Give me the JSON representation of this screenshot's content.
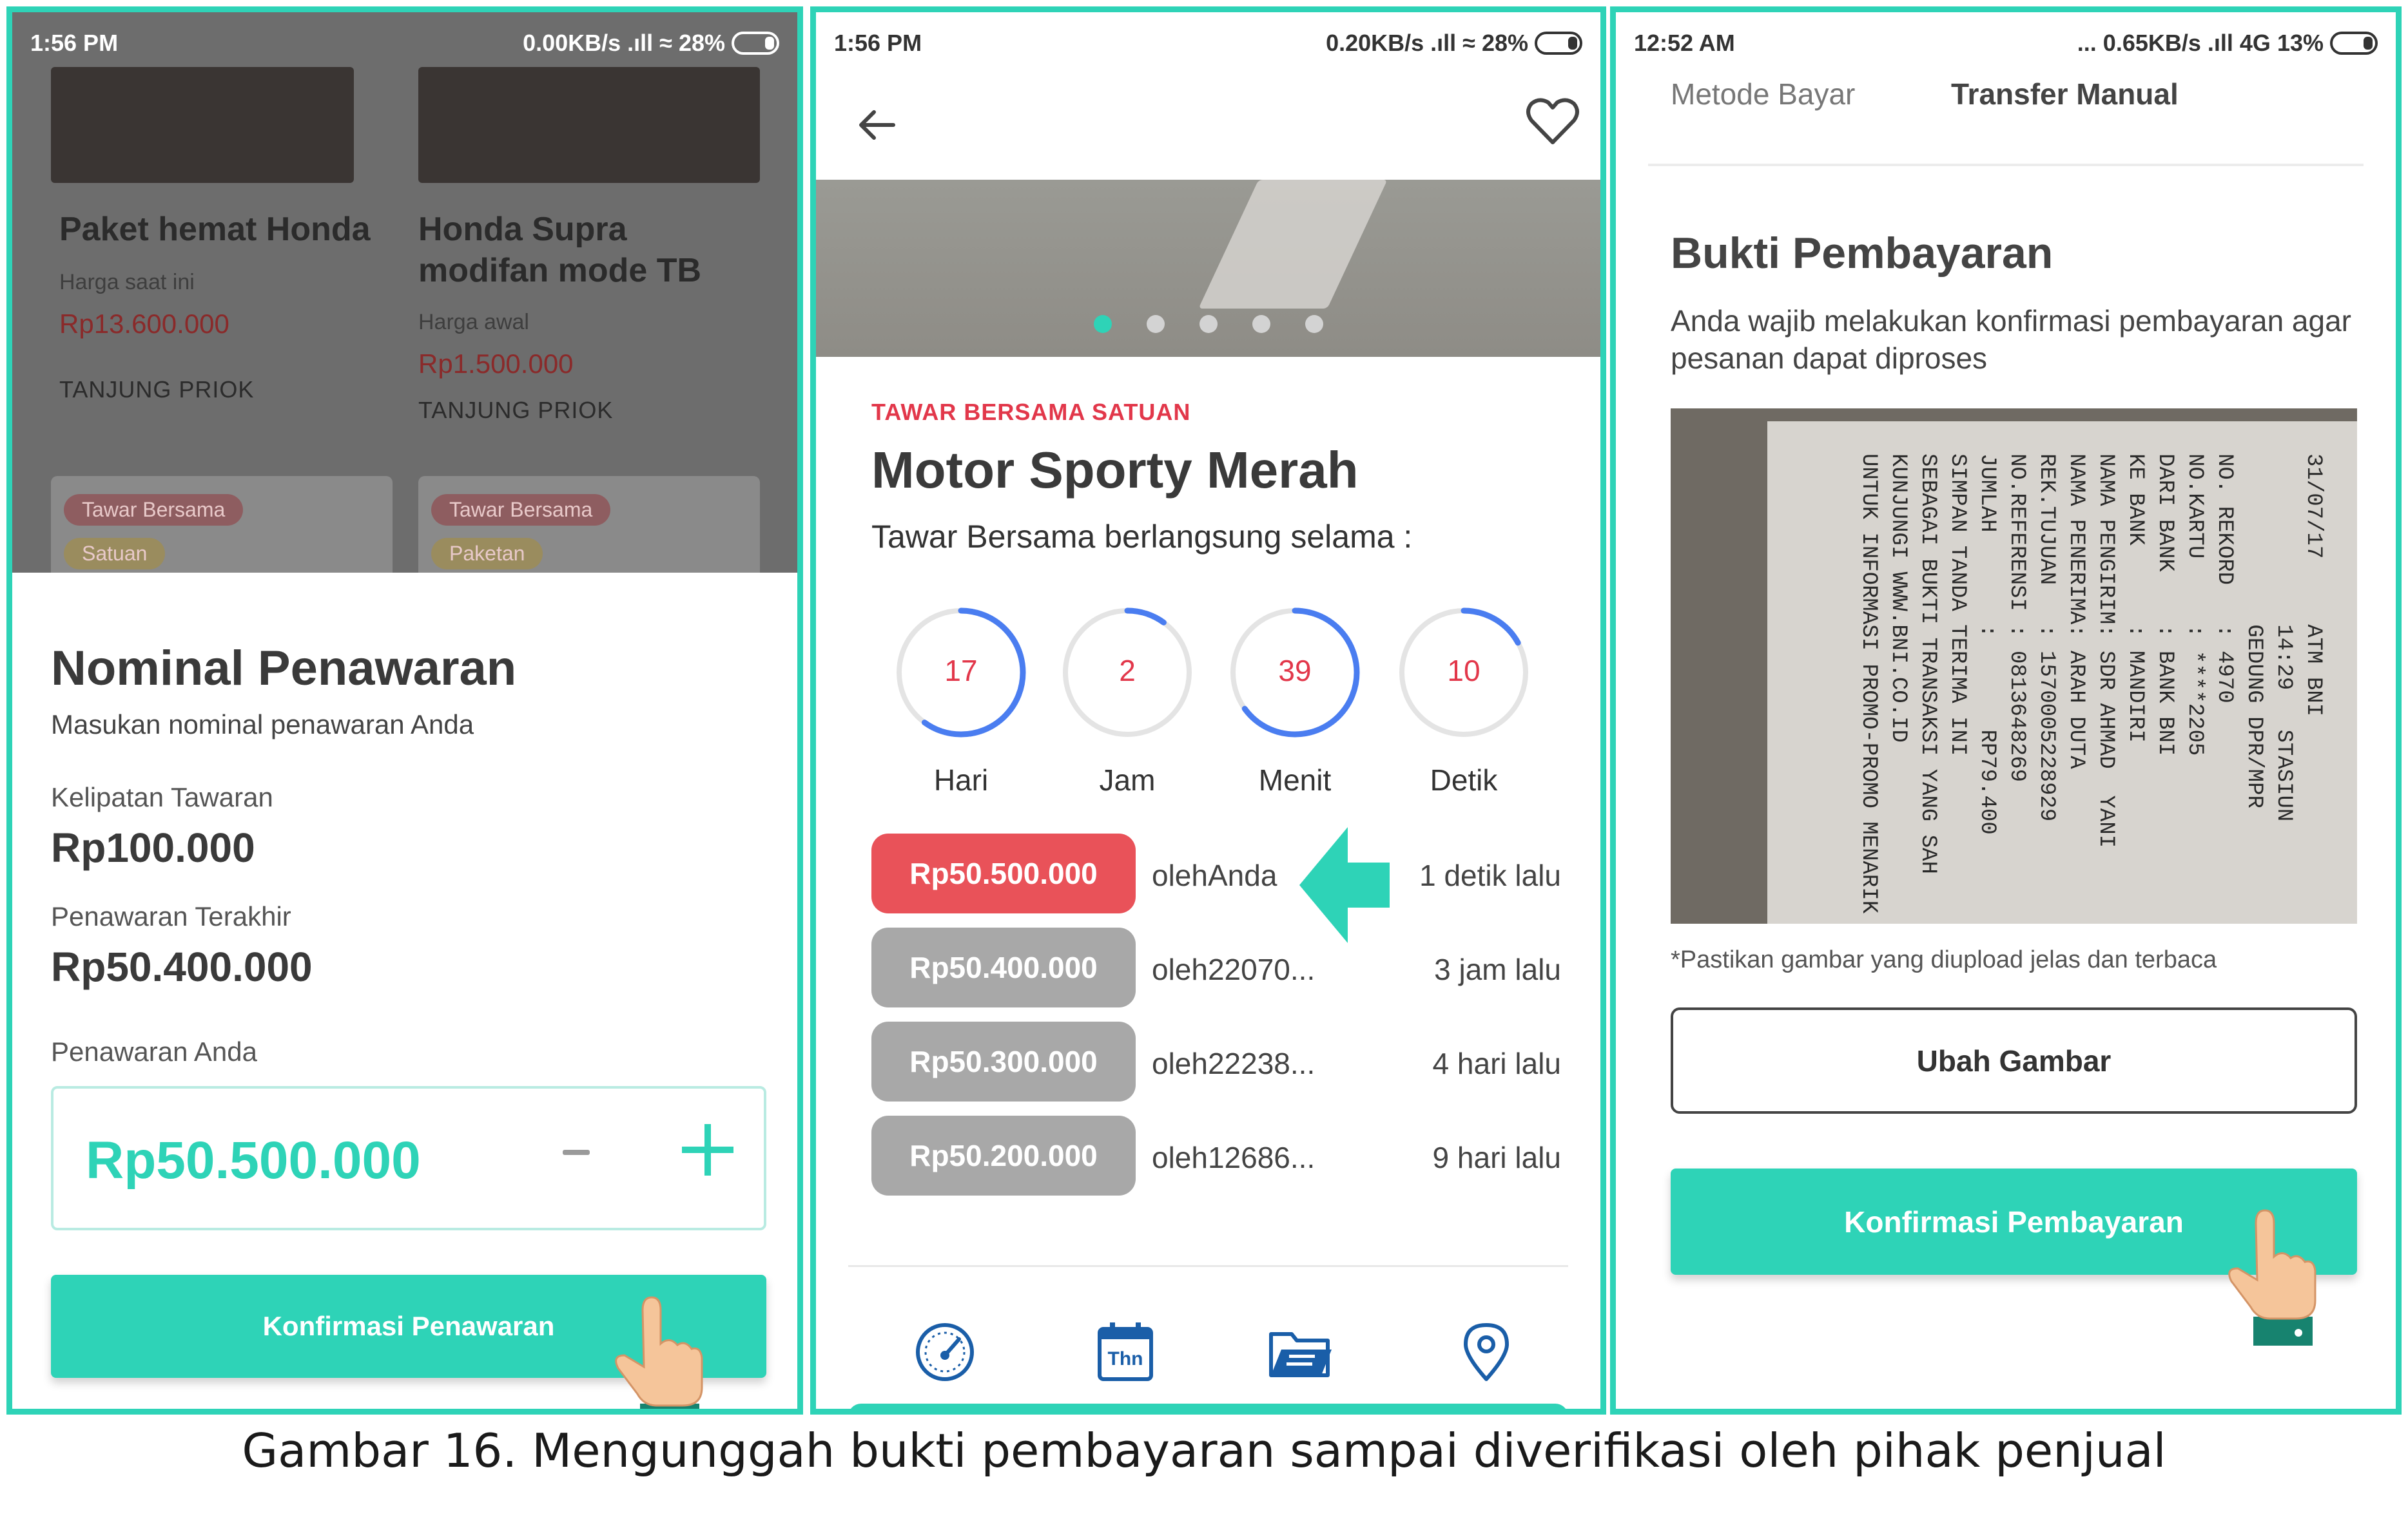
{
  "panel1": {
    "status": {
      "time": "1:56 PM",
      "net": "0.00KB/s .ıll",
      "battery": "28%"
    },
    "products": [
      {
        "title_line1": "Paket hemat Honda",
        "title_line2": "",
        "price_label": "Harga saat ini",
        "price": "Rp13.600.000",
        "location": "TANJUNG PRIOK"
      },
      {
        "title_line1": "Honda Supra",
        "title_line2": "modifan mode TB",
        "price_label": "Harga awal",
        "price": "Rp1.500.000",
        "location": "TANJUNG PRIOK"
      }
    ],
    "mini_cards": [
      {
        "badge1": "Tawar Bersama",
        "badge2": "Satuan"
      },
      {
        "badge1": "Tawar Bersama",
        "badge2": "Paketan"
      }
    ],
    "sheet": {
      "title": "Nominal Penawaran",
      "subtitle": "Masukan nominal penawaran Anda",
      "multiple_label": "Kelipatan Tawaran",
      "multiple_value": "Rp100.000",
      "last_label": "Penawaran Terakhir",
      "last_value": "Rp50.400.000",
      "yours_label": "Penawaran Anda",
      "yours_value": "Rp50.500.000",
      "confirm_button": "Konfirmasi Penawaran"
    }
  },
  "panel2": {
    "status": {
      "time": "1:56 PM",
      "net": "0.20KB/s .ıll",
      "battery": "28%"
    },
    "carousel_count": 5,
    "carousel_active": 0,
    "tag": "TAWAR BERSAMA SATUAN",
    "title": "Motor Sporty Merah",
    "subtitle": "Tawar Bersama berlangsung selama :",
    "timers": [
      {
        "value": "17",
        "label": "Hari",
        "fraction": 0.6
      },
      {
        "value": "2",
        "label": "Jam",
        "fraction": 0.1
      },
      {
        "value": "39",
        "label": "Menit",
        "fraction": 0.65
      },
      {
        "value": "10",
        "label": "Detik",
        "fraction": 0.17
      }
    ],
    "bids": [
      {
        "amount": "Rp50.500.000",
        "by": "olehAnda",
        "time": "1 detik lalu",
        "highlight": true
      },
      {
        "amount": "Rp50.400.000",
        "by": "oleh22070...",
        "time": "3 jam lalu",
        "highlight": false
      },
      {
        "amount": "Rp50.300.000",
        "by": "oleh22238...",
        "time": "4 hari lalu",
        "highlight": false
      },
      {
        "amount": "Rp50.200.000",
        "by": "oleh12686...",
        "time": "9 hari lalu",
        "highlight": false
      }
    ],
    "nav_icons": [
      "speedometer-icon",
      "calendar-icon",
      "folder-icon",
      "location-pin-icon"
    ],
    "calendar_text": "Thn"
  },
  "panel3": {
    "status": {
      "time": "12:52 AM",
      "net": "... 0.65KB/s .ıll 4G",
      "battery": "13%"
    },
    "method_label": "Metode Bayar",
    "method_value": "Transfer Manual",
    "title": "Bukti Pembayaran",
    "subtitle": "Anda wajib melakukan konfirmasi pembayaran agar pesanan dapat diproses",
    "receipt_lines": [
      "31/07/17     ATM BNI",
      "             14:29   STASIUN",
      "             GEDUNG DPR/MPR",
      "NO. REKORD   : 4970",
      "NO.KARTU     : ****2205",
      "DARI BANK    : BANK BNI",
      "KE BANK      : MANDIRI",
      "NAMA PENGIRIM: SDR AHMAD  YANI",
      "NAMA PENERIMA: ARAH DUTA",
      "REK.TUJUAN   : 1570005228929",
      "NO.REFERENSI : 0813648269",
      "JUMLAH       :       RP79.400",
      "SIMPAN TANDA TERIMA INI",
      "SEBAGAI BUKTI TRANSAKSI YANG SAH",
      "KUNJUNGI WWW.BNI.CO.ID",
      "UNTUK INFORMASI PROMO-PROMO MENARIK"
    ],
    "note": "*Pastikan gambar yang diupload jelas dan terbaca",
    "change_button": "Ubah Gambar",
    "confirm_button": "Konfirmasi Pembayaran"
  },
  "caption": "Gambar 16. Mengunggah bukti pembayaran sampai diverifikasi oleh pihak penjual",
  "colors": {
    "accent": "#2ed3b7",
    "danger": "#e95259",
    "muted_pill": "#a8a8a8",
    "ring_blue": "#4a7df0"
  }
}
